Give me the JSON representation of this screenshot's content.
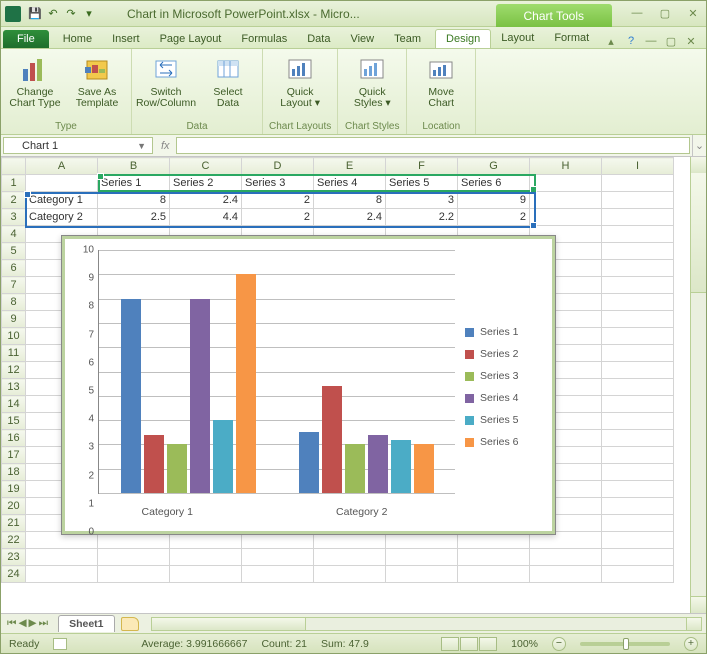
{
  "title": {
    "document": "Chart in Microsoft PowerPoint.xlsx - Micro...",
    "chart_tools": "Chart Tools"
  },
  "tabs": {
    "file": "File",
    "list": [
      "Home",
      "Insert",
      "Page Layout",
      "Formulas",
      "Data",
      "View",
      "Team"
    ],
    "context": [
      "Design",
      "Layout",
      "Format"
    ]
  },
  "ribbon": {
    "groups": [
      {
        "label": "Type",
        "buttons": [
          {
            "t1": "Change",
            "t2": "Chart Type",
            "icon": "bar-chart-icon"
          },
          {
            "t1": "Save As",
            "t2": "Template",
            "icon": "save-template-icon"
          }
        ]
      },
      {
        "label": "Data",
        "buttons": [
          {
            "t1": "Switch",
            "t2": "Row/Column",
            "icon": "switch-icon"
          },
          {
            "t1": "Select",
            "t2": "Data",
            "icon": "select-data-icon"
          }
        ]
      },
      {
        "label": "Chart Layouts",
        "buttons": [
          {
            "t1": "Quick",
            "t2": "Layout ▾",
            "icon": "quick-layout-icon"
          }
        ]
      },
      {
        "label": "Chart Styles",
        "buttons": [
          {
            "t1": "Quick",
            "t2": "Styles ▾",
            "icon": "quick-styles-icon"
          }
        ]
      },
      {
        "label": "Location",
        "buttons": [
          {
            "t1": "Move",
            "t2": "Chart",
            "icon": "move-chart-icon"
          }
        ]
      }
    ]
  },
  "namebox": "Chart 1",
  "fx_label": "fx",
  "columns": [
    "A",
    "B",
    "C",
    "D",
    "E",
    "F",
    "G",
    "H",
    "I"
  ],
  "rows": 24,
  "data_grid": {
    "headers": [
      "Series 1",
      "Series 2",
      "Series 3",
      "Series 4",
      "Series 5",
      "Series 6"
    ],
    "rows": [
      {
        "label": "Category 1",
        "vals": [
          "8",
          "2.4",
          "2",
          "8",
          "3",
          "9"
        ]
      },
      {
        "label": "Category 2",
        "vals": [
          "2.5",
          "4.4",
          "2",
          "2.4",
          "2.2",
          "2"
        ]
      }
    ]
  },
  "chart_data": {
    "type": "bar",
    "categories": [
      "Category 1",
      "Category 2"
    ],
    "series": [
      {
        "name": "Series 1",
        "values": [
          8,
          2.5
        ]
      },
      {
        "name": "Series 2",
        "values": [
          2.4,
          4.4
        ]
      },
      {
        "name": "Series 3",
        "values": [
          2,
          2
        ]
      },
      {
        "name": "Series 4",
        "values": [
          8,
          2.4
        ]
      },
      {
        "name": "Series 5",
        "values": [
          3,
          2.2
        ]
      },
      {
        "name": "Series 6",
        "values": [
          9,
          2
        ]
      }
    ],
    "ylim": [
      0,
      10
    ],
    "yticks": [
      0,
      1,
      2,
      3,
      4,
      5,
      6,
      7,
      8,
      9,
      10
    ],
    "title": "",
    "xlabel": "",
    "ylabel": ""
  },
  "sheet_tab": "Sheet1",
  "status": {
    "mode": "Ready",
    "avg_label": "Average:",
    "avg": "3.991666667",
    "count_label": "Count:",
    "count": "21",
    "sum_label": "Sum:",
    "sum": "47.9",
    "zoom": "100%"
  }
}
